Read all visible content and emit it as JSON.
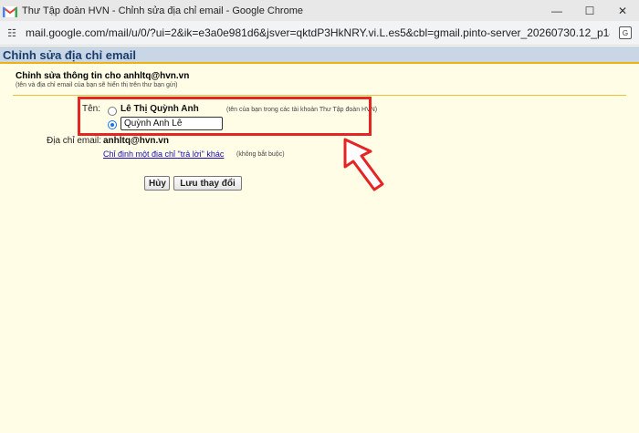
{
  "window": {
    "title": "Thư Tập đoàn HVN - Chỉnh sửa địa chỉ email - Google Chrome",
    "minimize_icon": "minimize-icon",
    "maximize_icon": "maximize-icon",
    "close_icon": "close-icon"
  },
  "address_bar": {
    "url": "mail.google.com/mail/u/0/?ui=2&ik=e3a0e981d6&jsver=qktdP3HkNRY.vi.L.es5&cbl=gmail.pinto-server_20260730.12_p1&view=cf&at..."
  },
  "page": {
    "header": "Chỉnh sửa địa chỉ email",
    "section_title": "Chỉnh sửa thông tin cho anhltq@hvn.vn",
    "section_subtitle": "(tên và địa chỉ email của bạn sẽ hiển thị trên thư bạn gửi)"
  },
  "form": {
    "name_label": "Tên:",
    "option1_label": "Lê Thị Quỳnh Anh",
    "option1_note": "(tên của bạn trong các tài khoản Thư Tập đoàn HVN)",
    "option2_selected": true,
    "name_input_value": "Quỳnh Anh Lê",
    "email_label": "Địa chỉ email:",
    "email_value": "anhltq@hvn.vn",
    "reply_link": "Chỉ định một địa chỉ \"trả lời\" khác",
    "reply_note": "(không bắt buộc)",
    "cancel_button": "Hủy",
    "save_button": "Lưu thay đổi"
  },
  "colors": {
    "header_bg": "#c8d6e5",
    "accent_line": "#f0b010",
    "highlight": "#e52424",
    "page_bg": "#fffde6"
  }
}
